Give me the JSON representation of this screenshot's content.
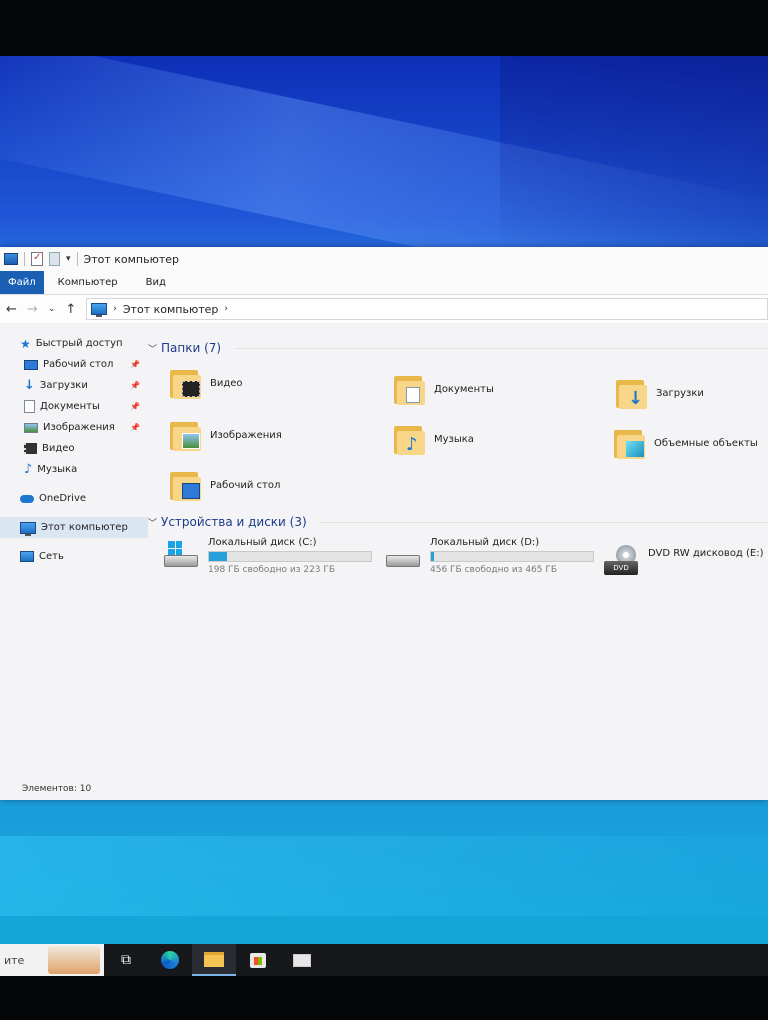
{
  "window": {
    "title": "Этот компьютер",
    "ribbon_tabs": [
      "Файл",
      "Компьютер",
      "Вид"
    ]
  },
  "address": {
    "path_label": "Этот компьютер"
  },
  "nav": {
    "quick_access": "Быстрый доступ",
    "items": [
      {
        "label": "Рабочий стол",
        "icon": "desktop-icon",
        "pinned": true
      },
      {
        "label": "Загрузки",
        "icon": "download-arrow-icon",
        "pinned": true
      },
      {
        "label": "Документы",
        "icon": "document-icon",
        "pinned": true
      },
      {
        "label": "Изображения",
        "icon": "pictures-icon",
        "pinned": true
      },
      {
        "label": "Видео",
        "icon": "video-icon",
        "pinned": false
      },
      {
        "label": "Музыка",
        "icon": "music-note-icon",
        "pinned": false
      }
    ],
    "onedrive": "OneDrive",
    "this_pc": "Этот компьютер",
    "network": "Сеть"
  },
  "folders": {
    "header": "Папки (7)",
    "items": [
      {
        "label": "Видео",
        "icon": "video-folder-icon"
      },
      {
        "label": "Документы",
        "icon": "documents-folder-icon"
      },
      {
        "label": "Загрузки",
        "icon": "downloads-folder-icon"
      },
      {
        "label": "Изображения",
        "icon": "pictures-folder-icon"
      },
      {
        "label": "Музыка",
        "icon": "music-folder-icon"
      },
      {
        "label": "Объемные объекты",
        "icon": "3d-objects-folder-icon"
      },
      {
        "label": "Рабочий стол",
        "icon": "desktop-folder-icon"
      }
    ]
  },
  "devices": {
    "header": "Устройства и диски (3)",
    "items": [
      {
        "label": "Локальный диск (C:)",
        "free": "198 ГБ свободно из 223 ГБ",
        "used_fraction": 0.11
      },
      {
        "label": "Локальный диск (D:)",
        "free": "456 ГБ свободно из 465 ГБ",
        "used_fraction": 0.02
      },
      {
        "label": "DVD RW дисковод (E:)",
        "badge": "DVD"
      }
    ]
  },
  "status": {
    "items_count": "Элементов: 10"
  },
  "taskbar": {
    "search_text": "ите",
    "accent": "#7fb4ea"
  },
  "colors": {
    "file_tab": "#1a5fb4",
    "drive_bar": "#26a0da",
    "group_header": "#1e3a8a"
  }
}
